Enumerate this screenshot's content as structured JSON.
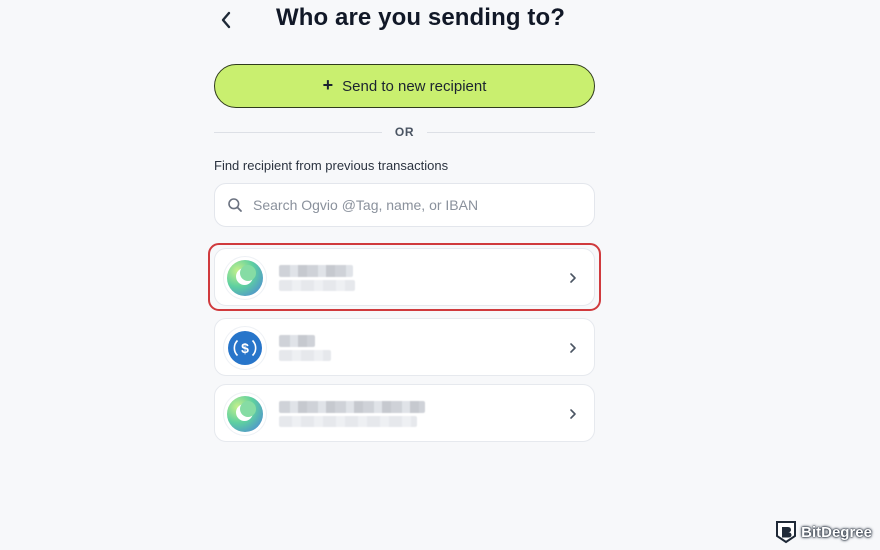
{
  "header": {
    "back_label": "<",
    "title": "Who are you sending to?"
  },
  "send_new": {
    "icon": "plus-icon",
    "plus": "+",
    "label": "Send to new recipient"
  },
  "divider": {
    "label": "OR"
  },
  "find": {
    "label": "Find recipient from previous transactions",
    "search_placeholder": "Search Ogvio @Tag, name, or IBAN",
    "search_value": ""
  },
  "recipients": [
    {
      "avatar": "ogvio-icon",
      "highlighted": true
    },
    {
      "avatar": "usdc-icon",
      "highlighted": false
    },
    {
      "avatar": "ogvio-icon",
      "highlighted": false
    }
  ],
  "watermark": {
    "label": "BitDegree"
  },
  "colors": {
    "accent_green": "#c9ef6f",
    "highlight_red": "#d03a3d",
    "usdc_blue": "#2775ca",
    "background": "#f7f8fa"
  }
}
